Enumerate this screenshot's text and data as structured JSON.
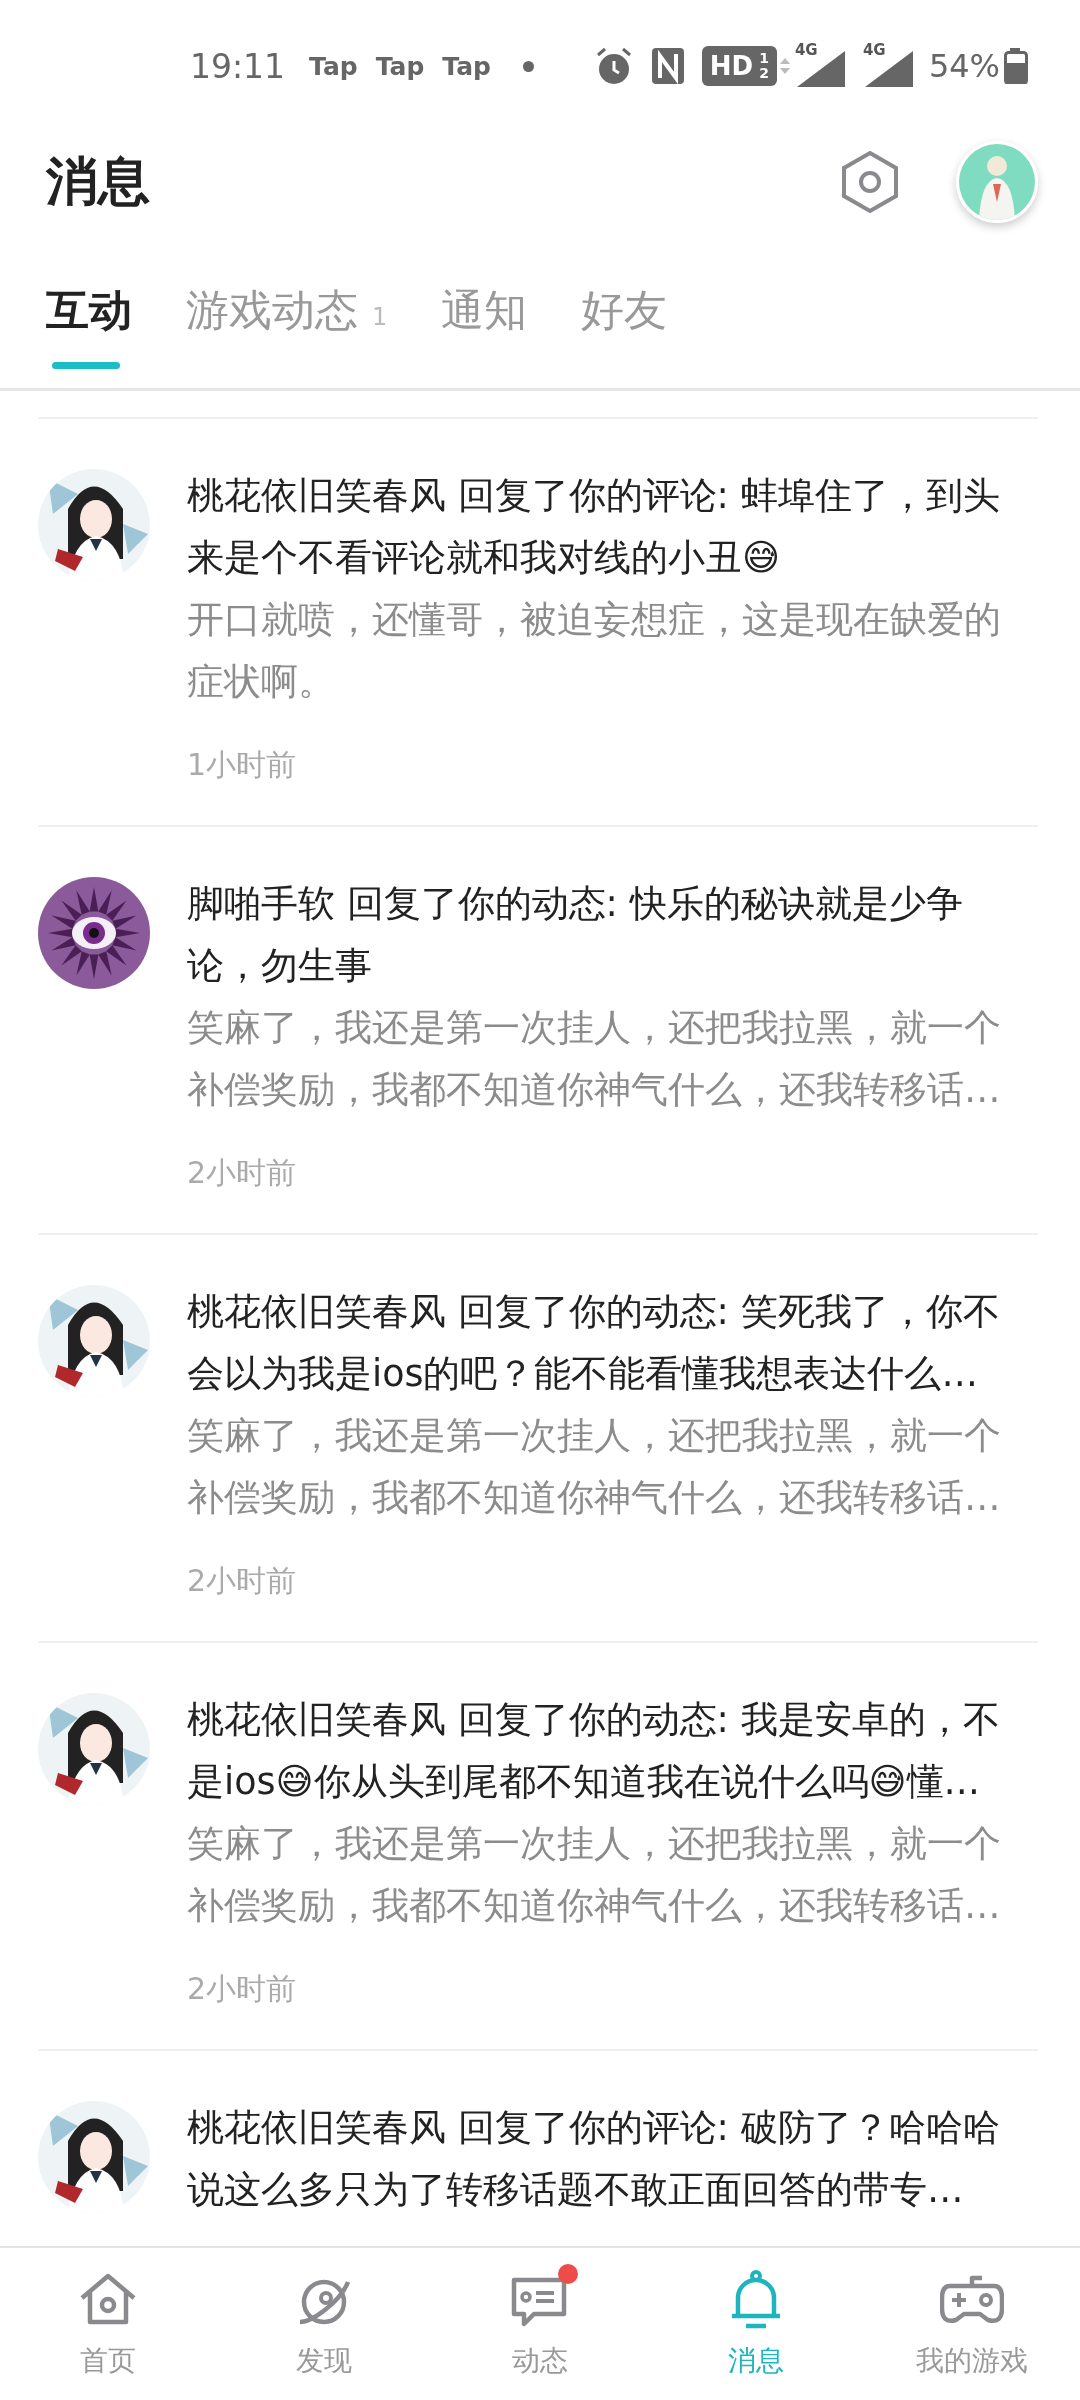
{
  "status_bar": {
    "time": "19:11",
    "notifications": [
      "Tap",
      "Tap",
      "Tap"
    ],
    "hd_badge": "HD",
    "hd_sub": [
      "1",
      "2"
    ],
    "networks": [
      "4G",
      "4G"
    ],
    "battery": "54%"
  },
  "header": {
    "title": "消息"
  },
  "tabs": [
    {
      "label": "互动",
      "selected": true
    },
    {
      "label": "游戏动态",
      "badge": "1",
      "selected": false
    },
    {
      "label": "通知",
      "selected": false
    },
    {
      "label": "好友",
      "selected": false
    }
  ],
  "messages": [
    {
      "kind": "figure",
      "title": "桃花依旧笑春风 回复了你的评论: 蚌埠住了，到头来是个不看评论就和我对线的小丑😅",
      "preview": "开口就喷，还懂哥，被迫妄想症，这是现在缺爱的症状啊。",
      "time": "1小时前"
    },
    {
      "kind": "eye",
      "title": "脚啪手软 回复了你的动态: 快乐的秘诀就是少争论，勿生事",
      "preview": "笑麻了，我还是第一次挂人，还把我拉黑，就一个补偿奖励，我都不知道你神气什么，还我转移话…",
      "time": "2小时前"
    },
    {
      "kind": "figure",
      "title": "桃花依旧笑春风 回复了你的动态: 笑死我了，你不会以为我是ios的吧？能不能看懂我想表达什么…",
      "preview": "笑麻了，我还是第一次挂人，还把我拉黑，就一个补偿奖励，我都不知道你神气什么，还我转移话…",
      "time": "2小时前"
    },
    {
      "kind": "figure",
      "title": "桃花依旧笑春风 回复了你的动态: 我是安卓的，不是ios😅你从头到尾都不知道我在说什么吗😅懂…",
      "preview": "笑麻了，我还是第一次挂人，还把我拉黑，就一个补偿奖励，我都不知道你神气什么，还我转移话…",
      "time": "2小时前"
    },
    {
      "kind": "figure",
      "title": "桃花依旧笑春风 回复了你的评论: 破防了？哈哈哈说这么多只为了转移话题不敢正面回答的带专…"
    }
  ],
  "nav": [
    {
      "label": "首页",
      "kind": "home",
      "selected": false,
      "dot": false
    },
    {
      "label": "发现",
      "kind": "planet",
      "selected": false,
      "dot": false
    },
    {
      "label": "动态",
      "kind": "chat",
      "selected": false,
      "dot": true
    },
    {
      "label": "消息",
      "kind": "bell",
      "selected": true,
      "dot": false
    },
    {
      "label": "我的游戏",
      "kind": "gamepad",
      "selected": false,
      "dot": false
    }
  ]
}
